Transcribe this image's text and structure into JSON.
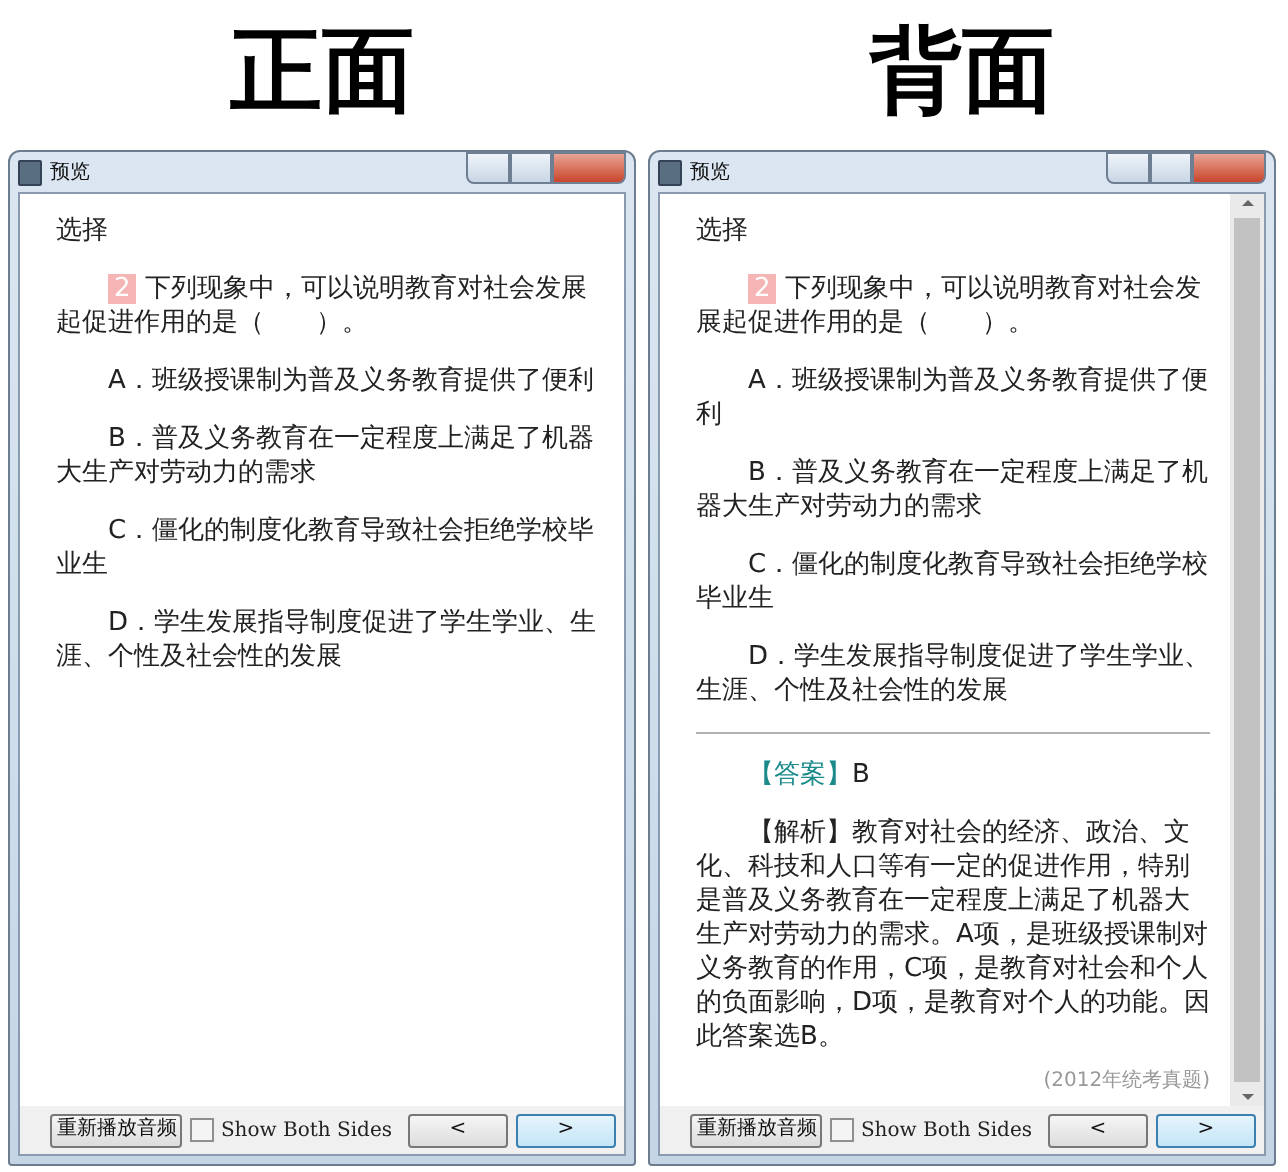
{
  "windows": [
    {
      "heading": "正面",
      "kind": "front",
      "title": "预览",
      "section": "选择",
      "question": {
        "number": "2",
        "text": "下列现象中，可以说明教育对社会发展起促进作用的是（　　）。"
      },
      "options": [
        "A．班级授课制为普及义务教育提供了便利",
        "B．普及义务教育在一定程度上满足了机器大生产对劳动力的需求",
        "C．僵化的制度化教育导致社会拒绝学校毕业生",
        "D．学生发展指导制度促进了学生学业、生涯、个性及社会性的发展"
      ],
      "footer": {
        "replay": "重新播放音频",
        "show_both": {
          "label": "Show Both Sides",
          "checked": false
        },
        "prev": "<",
        "next": ">"
      }
    },
    {
      "heading": "背面",
      "kind": "back",
      "title": "预览",
      "section": "选择",
      "question": {
        "number": "2",
        "text": "下列现象中，可以说明教育对社会发展起促进作用的是（　　）。"
      },
      "options": [
        "A．班级授课制为普及义务教育提供了便利",
        "B．普及义务教育在一定程度上满足了机器大生产对劳动力的需求",
        "C．僵化的制度化教育导致社会拒绝学校毕业生",
        "D．学生发展指导制度促进了学生学业、生涯、个性及社会性的发展"
      ],
      "answer": {
        "label": "【答案】",
        "value": "B"
      },
      "analysis": "【解析】教育对社会的经济、政治、文化、科技和人口等有一定的促进作用，特别是普及义务教育在一定程度上满足了机器大生产对劳动力的需求。A项，是班级授课制对义务教育的作用，C项，是教育对社会和个人的负面影响，D项，是教育对个人的功能。因此答案选B。",
      "source": "(2012年统考真题)",
      "footer": {
        "replay": "重新播放音频",
        "show_both": {
          "label": "Show Both Sides",
          "checked": false
        },
        "prev": "<",
        "next": ">"
      }
    }
  ]
}
